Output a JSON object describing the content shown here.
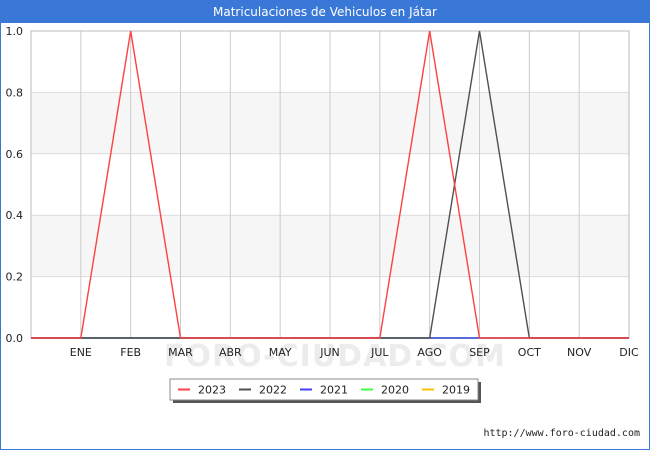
{
  "chart_data": {
    "type": "line",
    "title": "Matriculaciones de Vehiculos en Játar",
    "categories": [
      "ENE",
      "FEB",
      "MAR",
      "ABR",
      "MAY",
      "JUN",
      "JUL",
      "AGO",
      "SEP",
      "OCT",
      "NOV",
      "DIC"
    ],
    "ylim": [
      0,
      1
    ],
    "yticks": [
      "0.0",
      "0.2",
      "0.4",
      "0.6",
      "0.8",
      "1.0"
    ],
    "grid": true,
    "legend_position": "bottom",
    "series": [
      {
        "name": "2023",
        "color": "#ff4040",
        "values": [
          0,
          1,
          0,
          0,
          0,
          0,
          0,
          1,
          0,
          0,
          0,
          0
        ]
      },
      {
        "name": "2022",
        "color": "#505050",
        "values": [
          0,
          0,
          0,
          0,
          0,
          0,
          0,
          0,
          1,
          0,
          0,
          0
        ]
      },
      {
        "name": "2021",
        "color": "#4040ff",
        "values": [
          0,
          0,
          0,
          0,
          0,
          0,
          0,
          0,
          0,
          0,
          0,
          0
        ]
      },
      {
        "name": "2020",
        "color": "#40ff40",
        "values": [
          0,
          0,
          0,
          0,
          0,
          0,
          0,
          0,
          0,
          0,
          0,
          0
        ]
      },
      {
        "name": "2019",
        "color": "#ffc000",
        "values": [
          0,
          0,
          0,
          0,
          0,
          0,
          0,
          0,
          0,
          0,
          0,
          0
        ]
      }
    ],
    "watermark": "FORO-CIUDAD.COM"
  },
  "footer": {
    "url": "http://www.foro-ciudad.com"
  }
}
